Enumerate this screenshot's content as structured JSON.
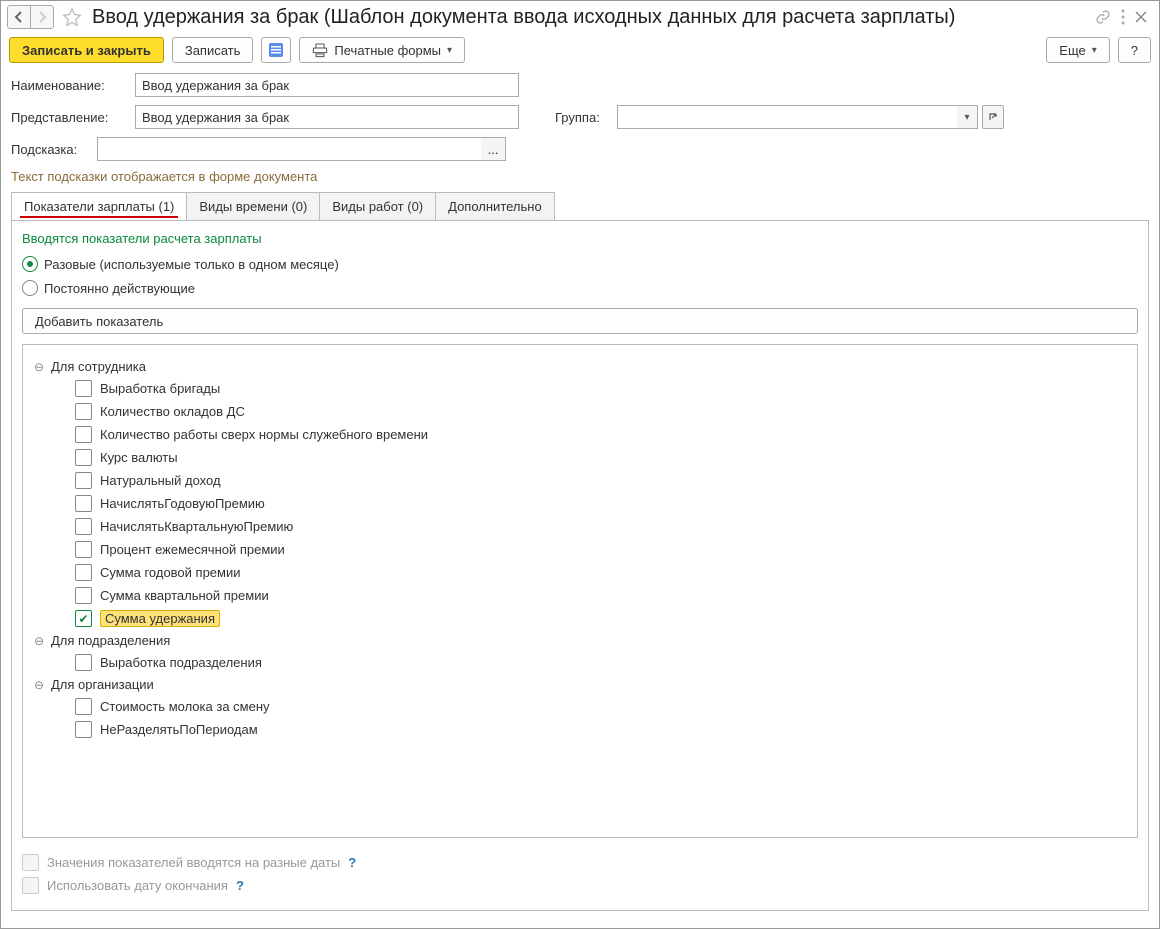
{
  "header": {
    "title": "Ввод удержания за брак (Шаблон документа ввода исходных данных для расчета зарплаты)"
  },
  "toolbar": {
    "save_close": "Записать и закрыть",
    "save": "Записать",
    "print_forms": "Печатные формы",
    "more": "Еще",
    "help": "?"
  },
  "fields": {
    "name_label": "Наименование:",
    "name_value": "Ввод удержания за брак",
    "presentation_label": "Представление:",
    "presentation_value": "Ввод удержания за брак",
    "group_label": "Группа:",
    "group_value": "",
    "hint_label": "Подсказка:",
    "hint_value": "",
    "hint_btn": "...",
    "hint_caption": "Текст подсказки отображается в форме документа"
  },
  "tabs": {
    "t1": "Показатели зарплаты (1)",
    "t2": "Виды времени (0)",
    "t3": "Виды работ (0)",
    "t4": "Дополнительно"
  },
  "tab1": {
    "section_title": "Вводятся показатели расчета зарплаты",
    "radio_once": "Разовые (используемые только в одном месяце)",
    "radio_perm": "Постоянно действующие",
    "add_indicator": "Добавить показатель",
    "groups": [
      {
        "label": "Для сотрудника",
        "items": [
          {
            "label": "Выработка бригады",
            "checked": false,
            "hl": false
          },
          {
            "label": "Количество окладов ДС",
            "checked": false,
            "hl": false
          },
          {
            "label": "Количество работы сверх нормы служебного времени",
            "checked": false,
            "hl": false
          },
          {
            "label": "Курс валюты",
            "checked": false,
            "hl": false
          },
          {
            "label": "Натуральный доход",
            "checked": false,
            "hl": false
          },
          {
            "label": "НачислятьГодовуюПремию",
            "checked": false,
            "hl": false
          },
          {
            "label": "НачислятьКвартальнуюПремию",
            "checked": false,
            "hl": false
          },
          {
            "label": "Процент ежемесячной премии",
            "checked": false,
            "hl": false
          },
          {
            "label": "Сумма годовой премии",
            "checked": false,
            "hl": false
          },
          {
            "label": "Сумма квартальной премии",
            "checked": false,
            "hl": false
          },
          {
            "label": "Сумма удержания",
            "checked": true,
            "hl": true
          }
        ]
      },
      {
        "label": "Для подразделения",
        "items": [
          {
            "label": "Выработка подразделения",
            "checked": false,
            "hl": false
          }
        ]
      },
      {
        "label": "Для организации",
        "items": [
          {
            "label": "Стоимость молока за смену",
            "checked": false,
            "hl": false
          },
          {
            "label": "НеРазделятьПоПериодам",
            "checked": false,
            "hl": false
          }
        ]
      }
    ],
    "opt_diff_dates": "Значения показателей вводятся на разные даты",
    "opt_end_date": "Использовать дату окончания"
  }
}
